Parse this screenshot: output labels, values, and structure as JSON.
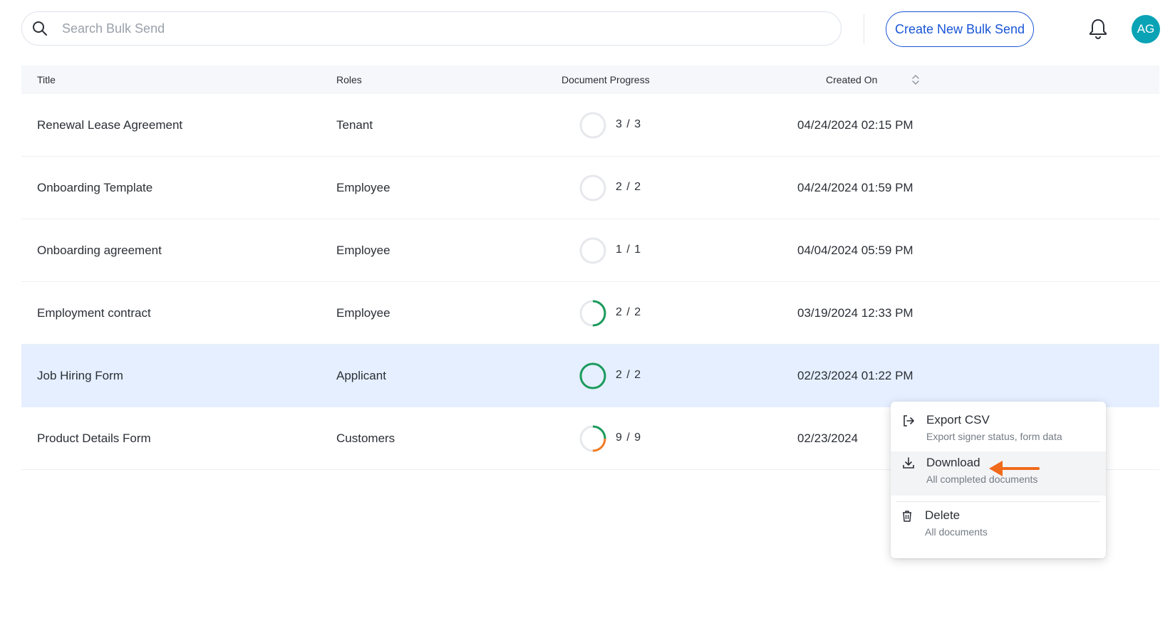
{
  "search": {
    "placeholder": "Search Bulk Send",
    "icon": "search-icon"
  },
  "header": {
    "create_button": "Create New Bulk Send",
    "notification_icon": "bell-icon",
    "avatar_initials": "AG"
  },
  "table": {
    "columns": {
      "title": "Title",
      "roles": "Roles",
      "progress": "Document Progress",
      "created": "Created On"
    },
    "rows": [
      {
        "title": "Renewal Lease Agreement",
        "role": "Tenant",
        "progress": "3 / 3",
        "created": "04/24/2024 02:15 PM",
        "ring_fraction": 0,
        "ring_color": "#1a9b5c"
      },
      {
        "title": "Onboarding Template",
        "role": "Employee",
        "progress": "2 / 2",
        "created": "04/24/2024 01:59 PM",
        "ring_fraction": 0,
        "ring_color": "#1a9b5c"
      },
      {
        "title": "Onboarding agreement",
        "role": "Employee",
        "progress": "1 / 1",
        "created": "04/04/2024 05:59 PM",
        "ring_fraction": 0,
        "ring_color": "#1a9b5c"
      },
      {
        "title": "Employment contract",
        "role": "Employee",
        "progress": "2 / 2",
        "created": "03/19/2024 12:33 PM",
        "ring_fraction": 0.5,
        "ring_color": "#1a9b5c"
      },
      {
        "title": "Job Hiring Form",
        "role": "Applicant",
        "progress": "2 / 2",
        "created": "02/23/2024 01:22 PM",
        "ring_fraction": 1,
        "ring_color": "#1a9b5c",
        "selected": true
      },
      {
        "title": "Product Details Form",
        "role": "Customers",
        "progress": "9 / 9",
        "created": "02/23/2024",
        "ring_fraction": 0.5,
        "ring_color": "#1a9b5c",
        "ring_color2": "#f07a22"
      }
    ]
  },
  "context_menu": {
    "items": [
      {
        "label": "Export CSV",
        "sub": "Export signer status, form data",
        "icon": "export-icon"
      },
      {
        "label": "Download",
        "sub": "All completed documents",
        "icon": "download-icon"
      },
      {
        "label": "Delete",
        "sub": "All documents",
        "icon": "trash-icon"
      }
    ]
  },
  "annotation": {
    "icon": "arrow-left-icon",
    "color": "#f06a1b"
  }
}
